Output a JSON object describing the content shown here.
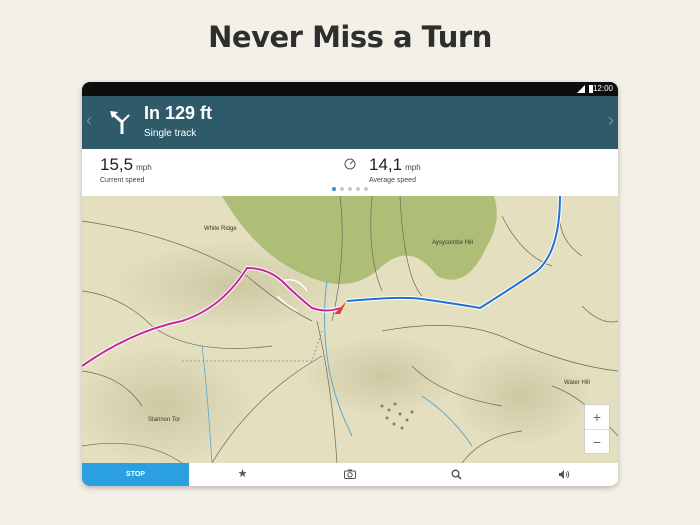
{
  "headline": "Never Miss a Turn",
  "status_bar": {
    "time": "12:00"
  },
  "navigation": {
    "distance": "In 129 ft",
    "road": "Single track",
    "turn_icon": "turn-left-icon"
  },
  "stats": {
    "current_speed": {
      "value": "15,5",
      "unit": "mph",
      "label": "Current speed"
    },
    "average_speed": {
      "value": "14,1",
      "unit": "mph",
      "label": "Average speed",
      "icon": "gauge-icon"
    },
    "page_dots": {
      "count": 5,
      "active": 1
    }
  },
  "map": {
    "labels": [
      "White Ridge",
      "Aysycombe Hill",
      "Water Hill",
      "Stannon Tor"
    ],
    "zoom_in": "+",
    "zoom_out": "−",
    "colors": {
      "route_done": "#c6289a",
      "route_ahead": "#1f6fd6",
      "woodland": "#a6b86a",
      "terrain": "#e3dfbf"
    }
  },
  "toolbar": {
    "stop_label": "STOP",
    "icons": [
      "star-icon",
      "camera-icon",
      "search-icon",
      "volume-icon"
    ]
  }
}
